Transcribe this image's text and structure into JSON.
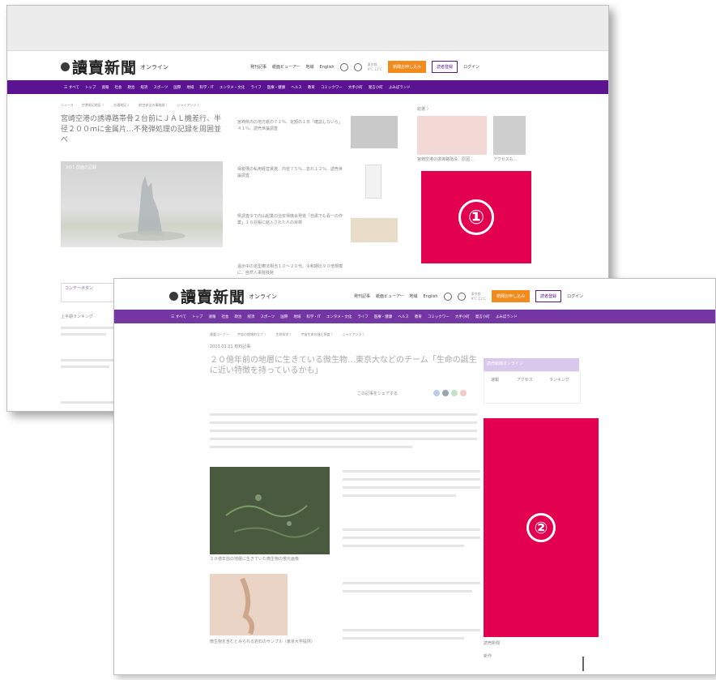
{
  "site": {
    "logo_text": "讀賣新聞",
    "logo_sub": "オンライン"
  },
  "header_links": [
    "発刊記事",
    "紙面ビューアー",
    "地域",
    "English"
  ],
  "weather": {
    "label": "東京都",
    "temp": "9°C 11°C"
  },
  "buttons": {
    "subscribe": "新聞お申し込み",
    "register": "読者登録",
    "login": "ログイン"
  },
  "nav_items": [
    "三 すべて",
    "トップ",
    "速報",
    "社会",
    "政治",
    "経済",
    "スポーツ",
    "国際",
    "地域",
    "科学・IT",
    "エンタメ・文化",
    "ライフ",
    "医療・健康",
    "ヘルス",
    "教育",
    "コミックワー",
    "大手小町",
    "発言小町",
    "よみぽランド"
  ],
  "shot1": {
    "breadcrumbs": [
      "ニュース",
      "空港周辺地区 〉",
      "交通地区 〉",
      "航空安全の事故調 〉",
      "ジャイアンツ 〉"
    ],
    "headline": "宮崎空港の誘導路帯骨２台前にＪＡＬ機差行、半径２００ｍに金属片…不発弾処理の記録を周囲並べ",
    "image_caption": "3の1 前面の記録",
    "side_items": [
      "宮崎県内の地方紙の７１％、定額の１日「確認しないら」４１％、読売世論調査",
      "保税債の私用経営賃渡、内容７５％…去れ１２％、読売世論調査",
      "県調査令で内山起業の治安帰機会発覚「自粛でも看一の作業」１０兆帳に結入された人の目標",
      "温示中の定型療法相当１０〜２０代、令和期比９０倍規模に、自然人事院検発"
    ],
    "right_label": "総選 〉",
    "right_thumb_captions": [
      "宮崎空港の誘導路陥没、原因…",
      "アクセスも…"
    ],
    "bottom_left": [
      "コンテーボタン",
      "上半期ランキング"
    ],
    "marker": "①"
  },
  "shot2": {
    "breadcrumbs": [
      "連載コーナー",
      "宇宙の地域的なク 〉",
      "生命科学 〉",
      "宇宙生命の謎と探査 〉",
      "ジャイアンツ 〉"
    ],
    "meta": "2023.01.21 有料記事",
    "headline": "２０億年前の地層に生きている微生物…東京大などのチーム「生命の誕生に近い特徴を持っているかも」",
    "share_label": "この記事をシェアする",
    "image_caption": "２０億年前の地層に生きていた微生物の蛍光画像",
    "photo_caption": "微生物を含むとみられる岩石のサンプル（東京大学提供）",
    "right_card": {
      "title": "読売新聞オンライン",
      "tabs": [
        "速報",
        "アクセス",
        "ランキング"
      ]
    },
    "right_bottom": [
      "読売新聞",
      "新作"
    ],
    "marker": "②"
  }
}
